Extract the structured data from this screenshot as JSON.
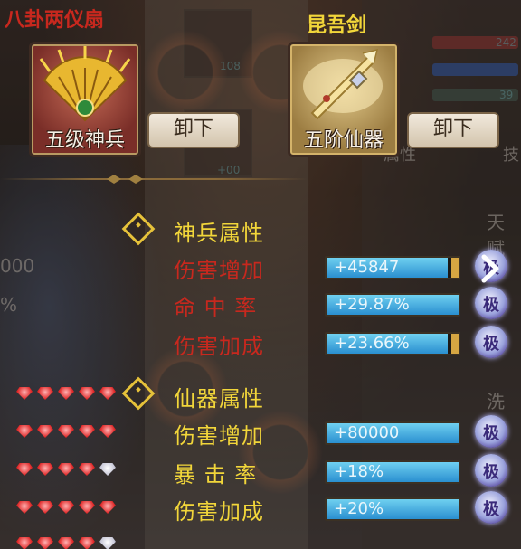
{
  "equipment": {
    "weapon": {
      "name": "八卦两仪扇",
      "tier": "五级神兵",
      "unequip_label": "卸下",
      "name_color": "#c8281e"
    },
    "artifact": {
      "name": "昆吾剑",
      "tier": "五阶仙器",
      "unequip_label": "卸下",
      "name_color": "#f2d63a"
    }
  },
  "divine_section": {
    "title": "神兵属性",
    "attributes": [
      {
        "label": "伤害增加",
        "value": "+45847",
        "color": "#c8281e",
        "fill_fraction": 0.92
      },
      {
        "label": "命 中 率",
        "value": "+29.87%",
        "color": "#c8281e",
        "fill_fraction": 1.0
      },
      {
        "label": "伤害加成",
        "value": "+23.66%",
        "color": "#c8281e",
        "fill_fraction": 0.92
      }
    ]
  },
  "immortal_section": {
    "title": "仙器属性",
    "attributes": [
      {
        "label": "伤害增加",
        "value": "+80000",
        "color": "#f2d63a",
        "fill_fraction": 1.0
      },
      {
        "label": "暴 击 率",
        "value": "+18%",
        "color": "#f2d63a",
        "fill_fraction": 1.0
      },
      {
        "label": "伤害加成",
        "value": "+20%",
        "color": "#f2d63a",
        "fill_fraction": 1.0
      }
    ]
  },
  "max_badge_label": "极",
  "gem_rows": [
    [
      "red",
      "red",
      "red",
      "red",
      "red"
    ],
    [
      "red",
      "red",
      "red",
      "red",
      "red"
    ],
    [
      "red",
      "red",
      "red",
      "red",
      "white"
    ],
    [
      "red",
      "red",
      "red",
      "red",
      "red"
    ],
    [
      "red",
      "red",
      "red",
      "red",
      "white"
    ]
  ],
  "background": {
    "left_stats": [
      "000",
      "%"
    ],
    "right_headers": [
      "天赋",
      "洗练"
    ],
    "right_buttons": [
      "属性",
      "技"
    ],
    "slot_values": [
      "108",
      "+00"
    ],
    "bar_values": [
      "242",
      "39"
    ]
  }
}
